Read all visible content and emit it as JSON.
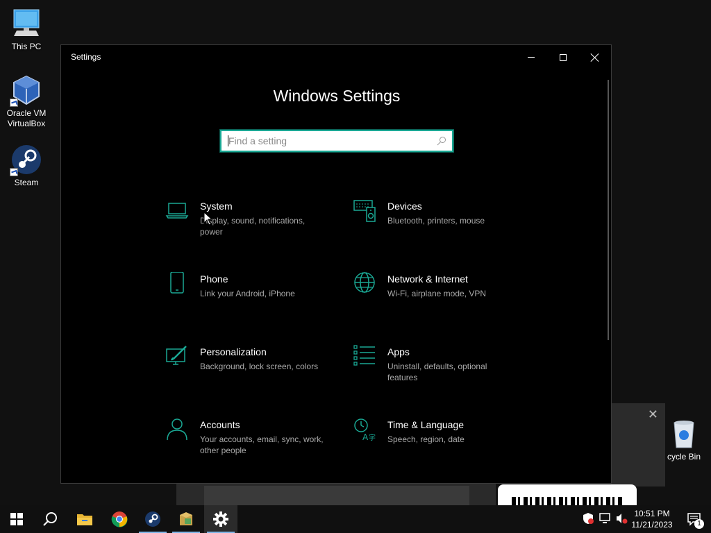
{
  "desktop": {
    "icons": [
      {
        "label": "This PC"
      },
      {
        "label": "Oracle VM VirtualBox"
      },
      {
        "label": "Steam"
      },
      {
        "label": "cycle Bin"
      }
    ]
  },
  "window": {
    "title": "Settings",
    "heading": "Windows Settings",
    "search": {
      "placeholder": "Find a setting",
      "value": ""
    }
  },
  "categories": [
    {
      "title": "System",
      "desc": "Display, sound, notifications, power",
      "icon": "laptop-icon"
    },
    {
      "title": "Devices",
      "desc": "Bluetooth, printers, mouse",
      "icon": "keyboard-speaker-icon"
    },
    {
      "title": "Phone",
      "desc": "Link your Android, iPhone",
      "icon": "phone-icon"
    },
    {
      "title": "Network & Internet",
      "desc": "Wi-Fi, airplane mode, VPN",
      "icon": "globe-icon"
    },
    {
      "title": "Personalization",
      "desc": "Background, lock screen, colors",
      "icon": "paint-brush-icon"
    },
    {
      "title": "Apps",
      "desc": "Uninstall, defaults, optional features",
      "icon": "list-icon"
    },
    {
      "title": "Accounts",
      "desc": "Your accounts, email, sync, work, other people",
      "icon": "person-icon"
    },
    {
      "title": "Time & Language",
      "desc": "Speech, region, date",
      "icon": "clock-language-icon"
    }
  ],
  "taskbar": {
    "time": "10:51 PM",
    "date": "11/21/2023",
    "notification_count": "1"
  },
  "colors": {
    "accent": "#1aa894",
    "window_bg": "#000000",
    "taskbar_bg": "#101010"
  }
}
